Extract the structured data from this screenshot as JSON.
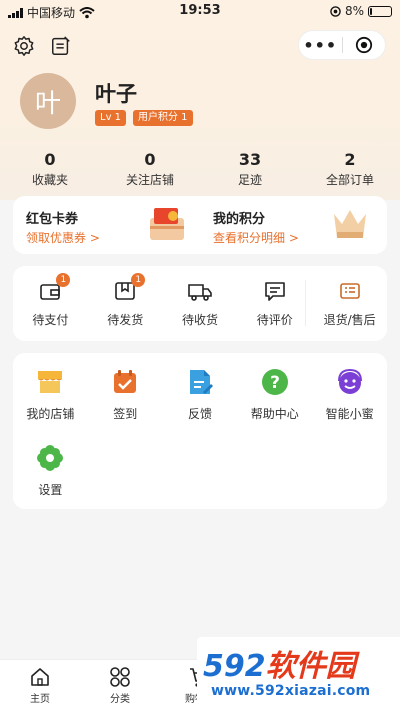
{
  "status_bar": {
    "carrier": "中国移动",
    "time": "19:53",
    "battery": "8%"
  },
  "capsule": {
    "more_label": "•••"
  },
  "profile": {
    "avatar_text": "叶",
    "name": "叶子",
    "level_badge": "Lv 1",
    "points_badge": "用户积分 1"
  },
  "stats": [
    {
      "value": "0",
      "label": "收藏夹"
    },
    {
      "value": "0",
      "label": "关注店铺"
    },
    {
      "value": "33",
      "label": "足迹"
    },
    {
      "value": "2",
      "label": "全部订单"
    }
  ],
  "coupons": {
    "left_title": "红包卡券",
    "left_link": "领取优惠券 >",
    "right_title": "我的积分",
    "right_link": "查看积分明细 >"
  },
  "orders": [
    {
      "label": "待支付",
      "icon": "wallet-icon",
      "badge": "1"
    },
    {
      "label": "待发货",
      "icon": "package-icon",
      "badge": "1"
    },
    {
      "label": "待收货",
      "icon": "truck-icon",
      "badge": ""
    },
    {
      "label": "待评价",
      "icon": "comment-icon",
      "badge": ""
    },
    {
      "label": "退货/售后",
      "icon": "after-sale-icon",
      "badge": ""
    }
  ],
  "tools": [
    {
      "label": "我的店铺",
      "icon": "store-icon"
    },
    {
      "label": "签到",
      "icon": "calendar-check-icon"
    },
    {
      "label": "反馈",
      "icon": "feedback-icon"
    },
    {
      "label": "帮助中心",
      "icon": "help-icon"
    },
    {
      "label": "智能小蜜",
      "icon": "assistant-icon"
    },
    {
      "label": "设置",
      "icon": "settings-flower-icon"
    }
  ],
  "tabbar": [
    {
      "label": "主页",
      "icon": "home-icon"
    },
    {
      "label": "分类",
      "icon": "category-icon"
    },
    {
      "label": "购物车",
      "icon": "cart-icon"
    }
  ],
  "watermark": {
    "brand_num": "592",
    "brand_text": "软件园",
    "url": "www.592xiazai.com"
  },
  "colors": {
    "accent": "#e8712d",
    "header_bg": "#fdf1e3",
    "watermark_red": "#e4391b",
    "watermark_blue": "#1c6fd0"
  }
}
